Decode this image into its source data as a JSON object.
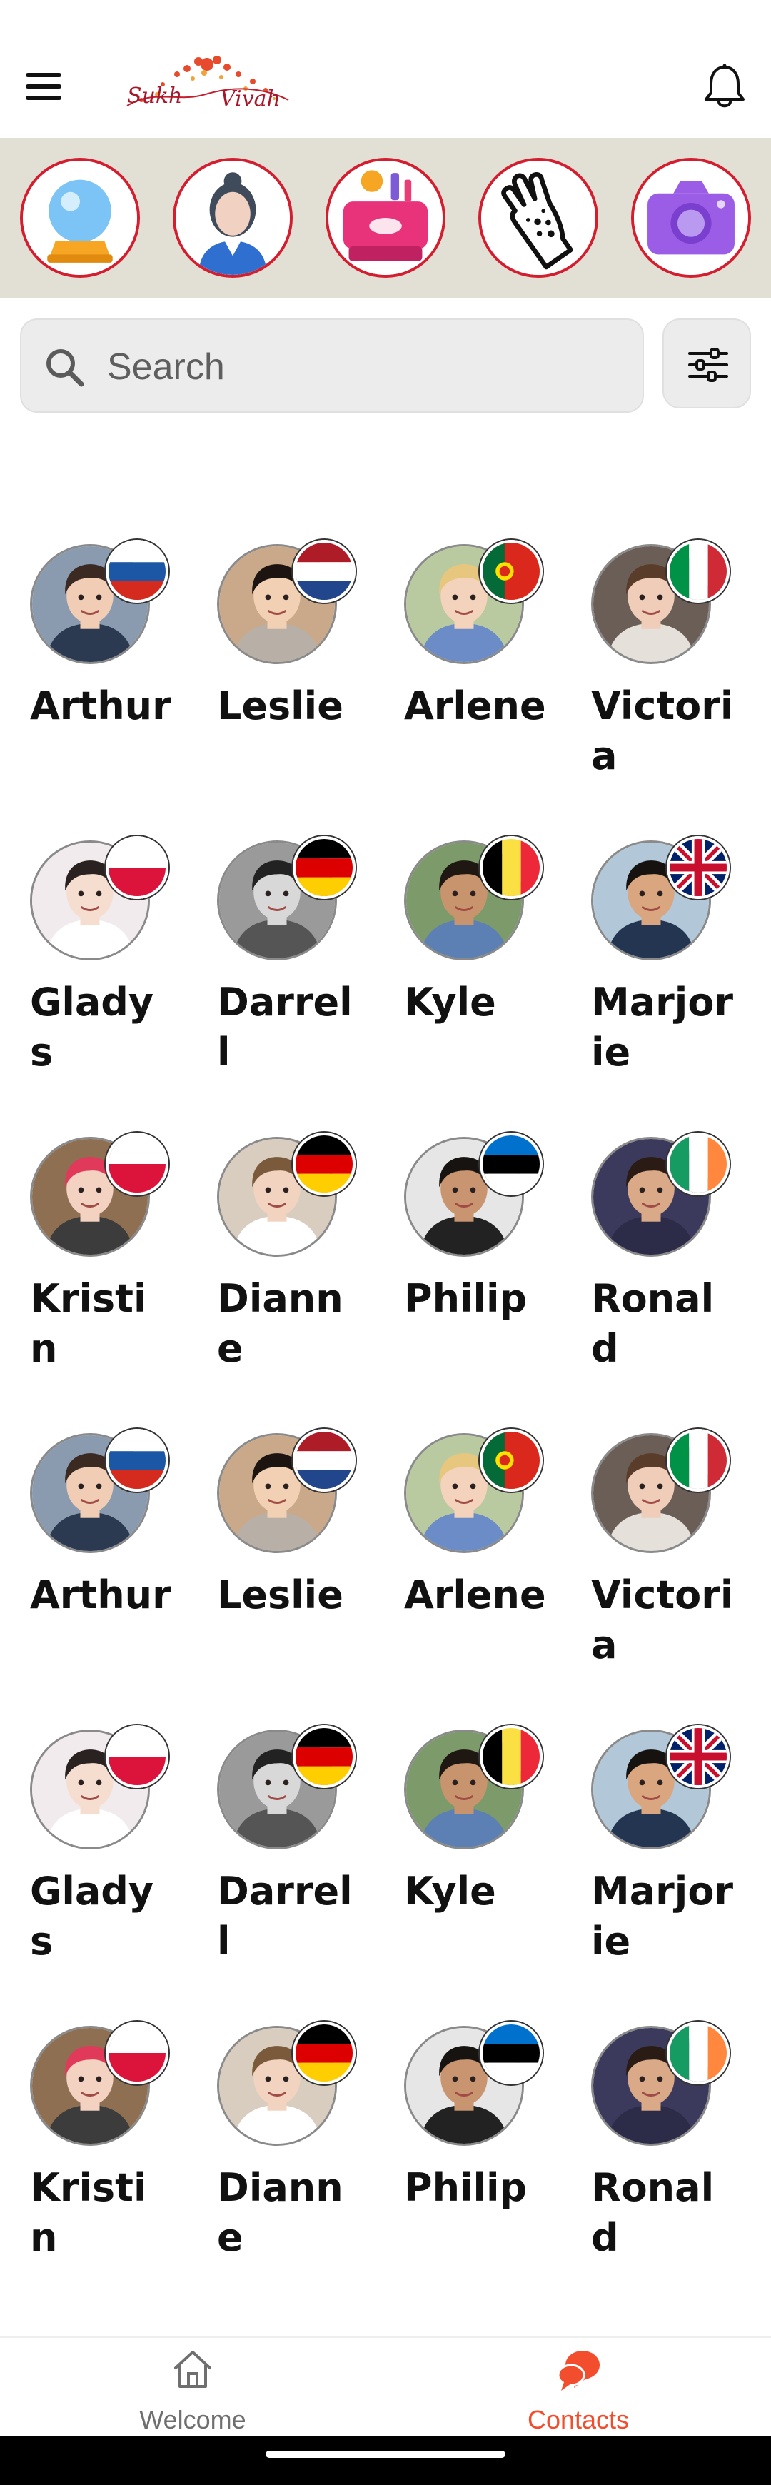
{
  "app": {
    "logo_text": "Sukh Vivah"
  },
  "categories": [
    {
      "name": "fortune-crystal-ball"
    },
    {
      "name": "receptionist"
    },
    {
      "name": "beauty-cosmetics"
    },
    {
      "name": "henna-hand"
    },
    {
      "name": "camera"
    }
  ],
  "search": {
    "placeholder": "Search",
    "value": ""
  },
  "contacts": [
    {
      "name": "Arthur",
      "flag": "russia"
    },
    {
      "name": "Leslie",
      "flag": "netherlands"
    },
    {
      "name": "Arlene",
      "flag": "portugal"
    },
    {
      "name": "Victoria",
      "flag": "italy"
    },
    {
      "name": "Gladys",
      "flag": "poland"
    },
    {
      "name": "Darrell",
      "flag": "germany"
    },
    {
      "name": "Kyle",
      "flag": "belgium"
    },
    {
      "name": "Marjorie",
      "flag": "united-kingdom"
    },
    {
      "name": "Kristin",
      "flag": "poland"
    },
    {
      "name": "Dianne",
      "flag": "germany"
    },
    {
      "name": "Philip",
      "flag": "estonia"
    },
    {
      "name": "Ronald",
      "flag": "ireland"
    },
    {
      "name": "Arthur",
      "flag": "russia"
    },
    {
      "name": "Leslie",
      "flag": "netherlands"
    },
    {
      "name": "Arlene",
      "flag": "portugal"
    },
    {
      "name": "Victoria",
      "flag": "italy"
    },
    {
      "name": "Gladys",
      "flag": "poland"
    },
    {
      "name": "Darrell",
      "flag": "germany"
    },
    {
      "name": "Kyle",
      "flag": "belgium"
    },
    {
      "name": "Marjorie",
      "flag": "united-kingdom"
    },
    {
      "name": "Kristin",
      "flag": "poland"
    },
    {
      "name": "Dianne",
      "flag": "germany"
    },
    {
      "name": "Philip",
      "flag": "estonia"
    },
    {
      "name": "Ronald",
      "flag": "ireland"
    }
  ],
  "nav": {
    "welcome_label": "Welcome",
    "contacts_label": "Contacts",
    "active": "contacts"
  },
  "colors": {
    "accent": "#f24e2e",
    "category_border": "#d41d2f",
    "strip_bg": "#e2e0d4",
    "inactive": "#6f6f6f"
  }
}
